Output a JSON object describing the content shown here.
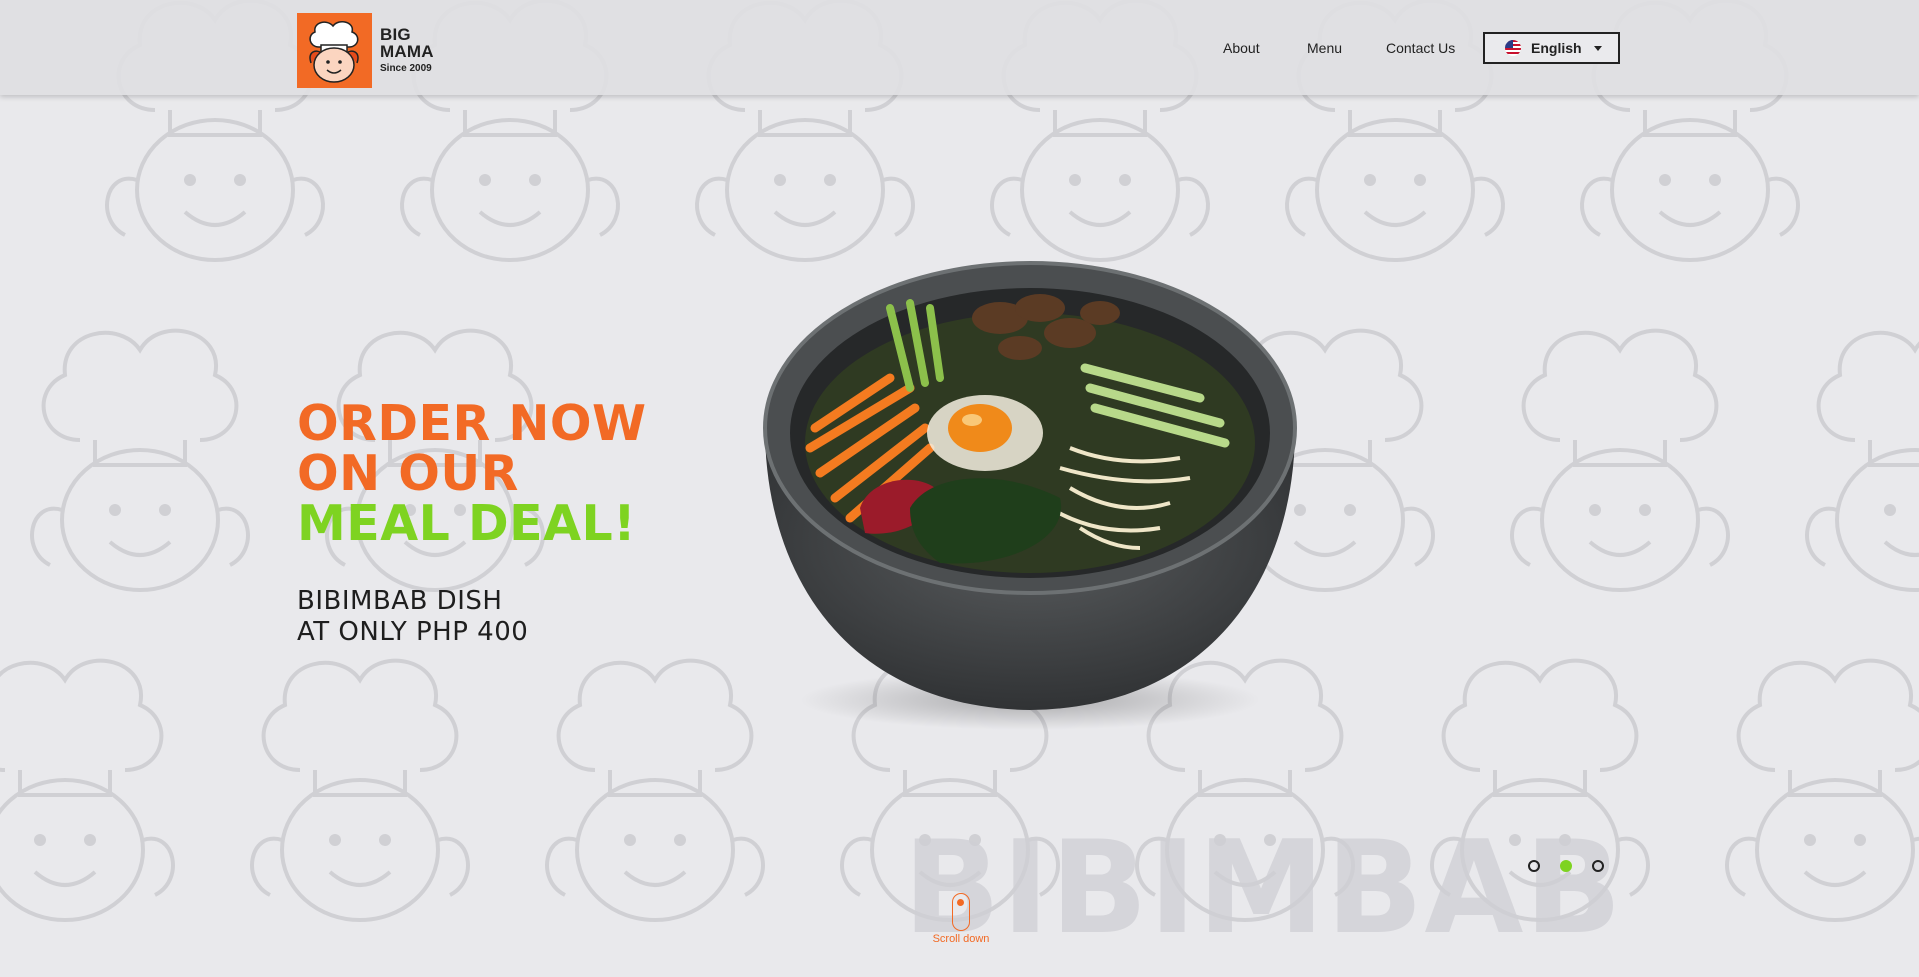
{
  "brand": {
    "logo_icon": "chef-mascot-icon",
    "name_line1": "BIG",
    "name_line2": "MAMA",
    "since": "Since 2009",
    "color": "#f26a25"
  },
  "nav": {
    "items": [
      {
        "label": "About"
      },
      {
        "label": "Menu"
      },
      {
        "label": "Contact Us"
      }
    ],
    "language": {
      "label": "English",
      "flag_icon": "us-flag-icon"
    }
  },
  "hero": {
    "headline_line1": "ORDER NOW",
    "headline_line2": "ON OUR",
    "headline_line3": "MEAL DEAL!",
    "sub_line1": "BIBIMBAB DISH",
    "sub_line2": "AT ONLY PHP 400",
    "watermark": "BIBIMBAB",
    "image_icon": "bibimbap-bowl-image",
    "accent_orange": "#f26a25",
    "accent_green": "#7ed321"
  },
  "carousel": {
    "slide_count": 3,
    "active_index": 1
  },
  "scroll": {
    "label": "Scroll down",
    "icon": "mouse-icon"
  }
}
